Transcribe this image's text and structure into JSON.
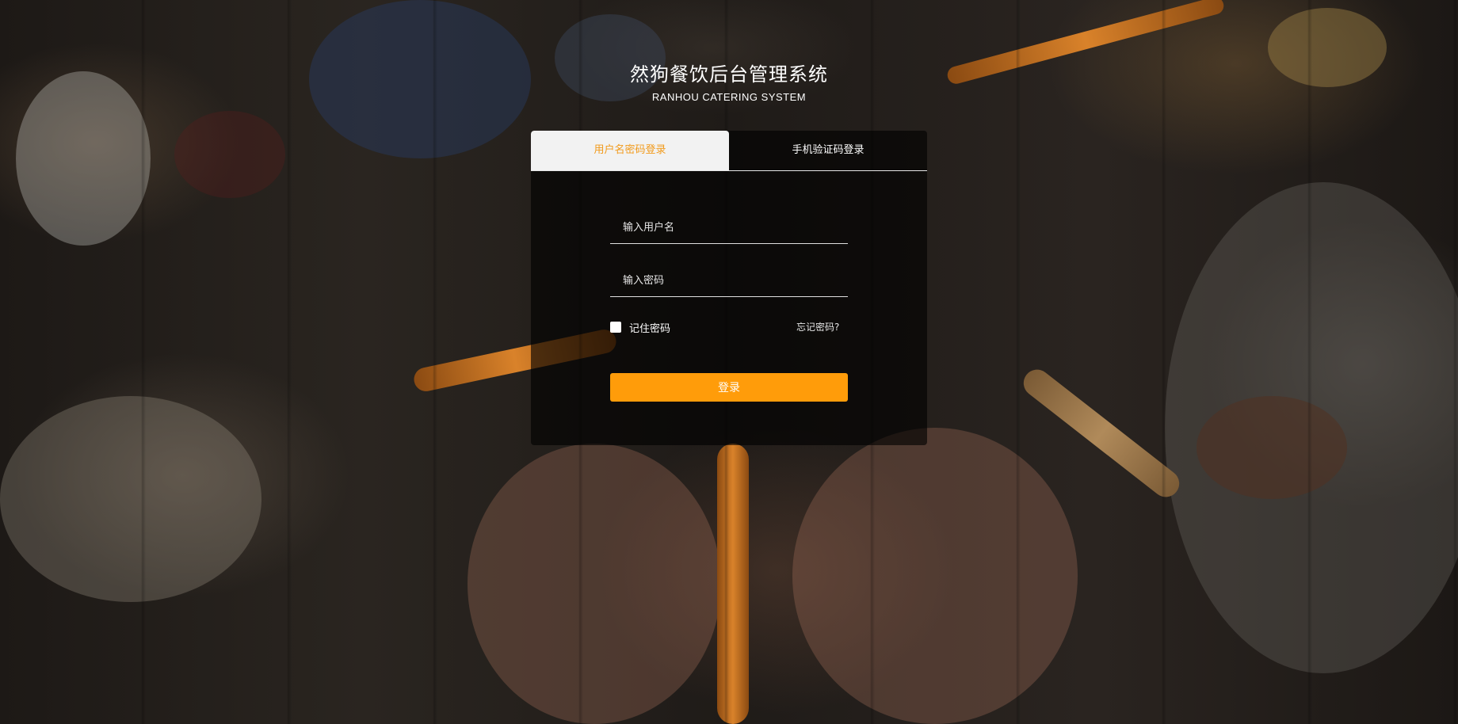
{
  "app": {
    "title_cn": "然狗餐饮后台管理系统",
    "title_en": "RANHOU CATERING SYSTEM"
  },
  "tabs": [
    {
      "label": "用户名密码登录",
      "active": true
    },
    {
      "label": "手机验证码登录",
      "active": false
    }
  ],
  "form": {
    "username_placeholder": "输入用户名",
    "password_placeholder": "输入密码",
    "remember_label": "记住密码",
    "forgot_label": "忘记密码?",
    "submit_label": "登录"
  },
  "colors": {
    "accent": "#ff9c0a",
    "active_tab_text": "#f29a1a"
  }
}
